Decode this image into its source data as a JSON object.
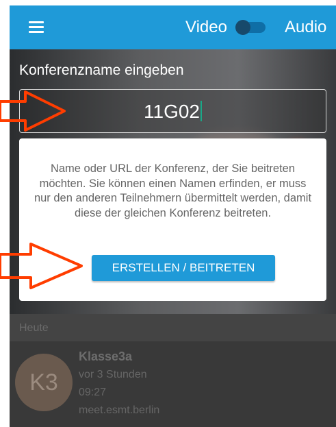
{
  "appbar": {
    "menu_icon": "hamburger-menu-icon",
    "video_label": "Video",
    "audio_label": "Audio",
    "accent_color": "#1f9ad8"
  },
  "conference": {
    "label": "Konferenzname eingeben",
    "value": "11G02"
  },
  "card": {
    "description": "Name oder URL der Konferenz, der Sie beitreten möchten. Sie können einen Namen erfinden, er muss nur den anderen Teilnehmern übermittelt werden, damit diese der gleichen Konferenz beitreten.",
    "button_label": "ERSTELLEN / BEITRETEN"
  },
  "recent": {
    "section_title": "Heute",
    "items": [
      {
        "initials": "K3",
        "title": "Klasse3a",
        "time_ago": "vor 3 Stunden",
        "time": "09:27",
        "server": "meet.esmt.berlin"
      }
    ]
  },
  "annotations": {
    "arrow_color": "#ff3d00"
  }
}
